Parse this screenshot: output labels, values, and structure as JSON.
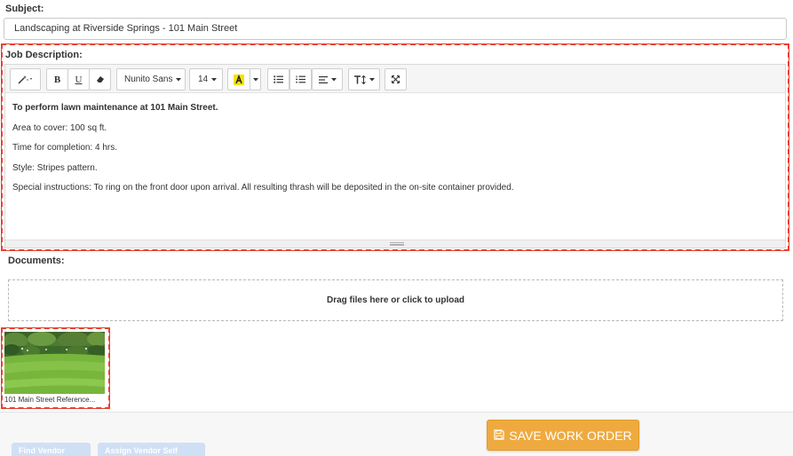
{
  "subject": {
    "label": "Subject:",
    "value": "Landscaping at Riverside Springs - 101 Main Street"
  },
  "job_description": {
    "label": "Job Description:",
    "toolbar": {
      "font_name": "Nunito Sans",
      "font_size": "14"
    },
    "content": [
      "To perform lawn maintenance at 101 Main Street.",
      "Area to cover: 100 sq ft.",
      "Time for completion: 4 hrs.",
      "Style: Stripes pattern.",
      "Special instructions: To ring on the front door upon arrival. All resulting thrash will be deposited in the on-site container provided."
    ]
  },
  "documents": {
    "label": "Documents:",
    "dropzone_text": "Drag files here or click to upload",
    "files": [
      {
        "name": "101 Main Street Reference..."
      }
    ]
  },
  "footer": {
    "find_vendor_label": "Find Vendor",
    "assign_vendor_label": "Assign Vendor Self",
    "save_label": "SAVE WORK ORDER"
  },
  "colors": {
    "annotation_red": "#e8412e",
    "save_button": "#efaa3f",
    "highlight_yellow": "#f5e400"
  }
}
